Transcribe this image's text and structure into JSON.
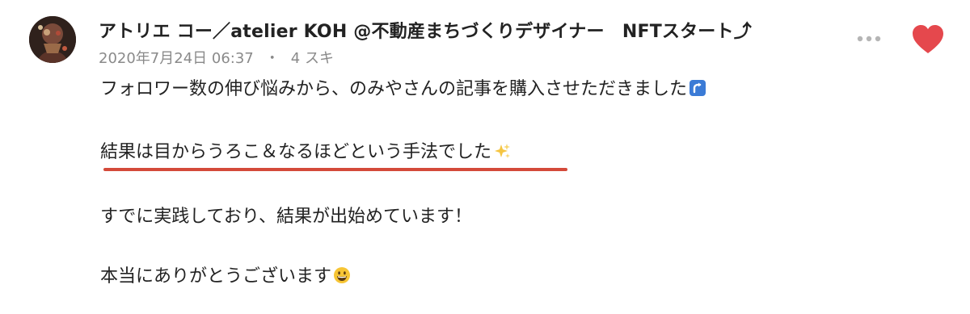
{
  "comment": {
    "author_name": "アトリエ コー／atelier KOH @不動産まちづくりデザイナー　NFTスタート⤴",
    "date": "2020年7月24日 06:37",
    "meta_separator": "・",
    "likes_label": "4 スキ",
    "paragraphs": [
      "フォロワー数の伸び悩みから、のみやさんの記事を購入させただきました",
      "結果は目からうろこ＆なるほどという手法でした",
      "すでに実践しており、結果が出始めています！",
      "本当にありがとうございます"
    ],
    "emoji": {
      "p1": "arrow-up-right-box-icon",
      "p2": "sparkles-icon",
      "p4": "grinning-face-icon"
    }
  },
  "colors": {
    "heart": "#e5484d",
    "underline": "#d44a3a",
    "meta_text": "#8a8a8a",
    "dots": "#b5b5b5"
  }
}
